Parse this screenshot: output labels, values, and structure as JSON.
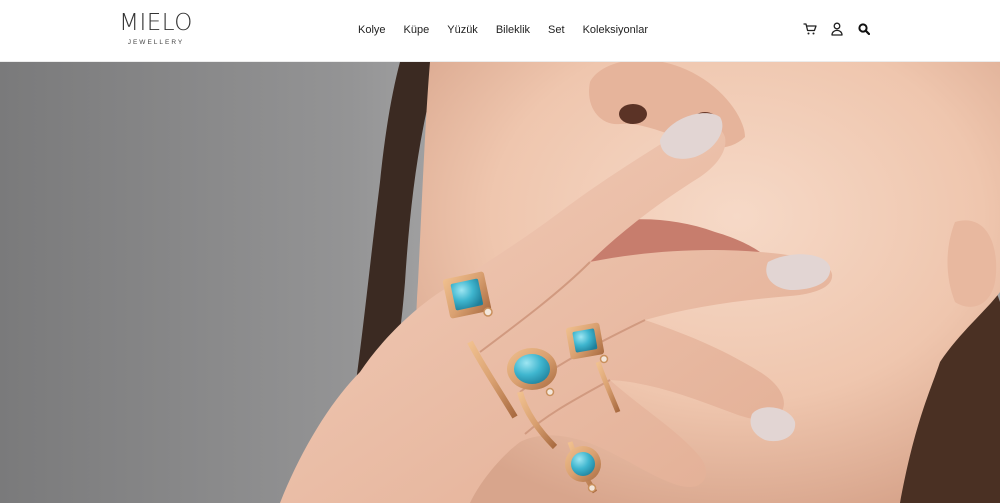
{
  "brand": {
    "name": "MIELO",
    "tagline": "JEWELLERY"
  },
  "nav": {
    "items": [
      {
        "label": "Kolye"
      },
      {
        "label": "Küpe"
      },
      {
        "label": "Yüzük"
      },
      {
        "label": "Bileklik"
      },
      {
        "label": "Set"
      },
      {
        "label": "Koleksiyonlar"
      }
    ]
  },
  "header_icons": [
    {
      "name": "cart-icon"
    },
    {
      "name": "user-icon"
    },
    {
      "name": "search-icon"
    }
  ],
  "hero": {
    "image": "woman-with-turquoise-gold-rings",
    "colors": {
      "background": "#7f7f80",
      "skin": "#efc8b3",
      "gold": "#d9a070",
      "turquoise": "#3fb6cf",
      "nail": "#e2d5d3"
    }
  }
}
